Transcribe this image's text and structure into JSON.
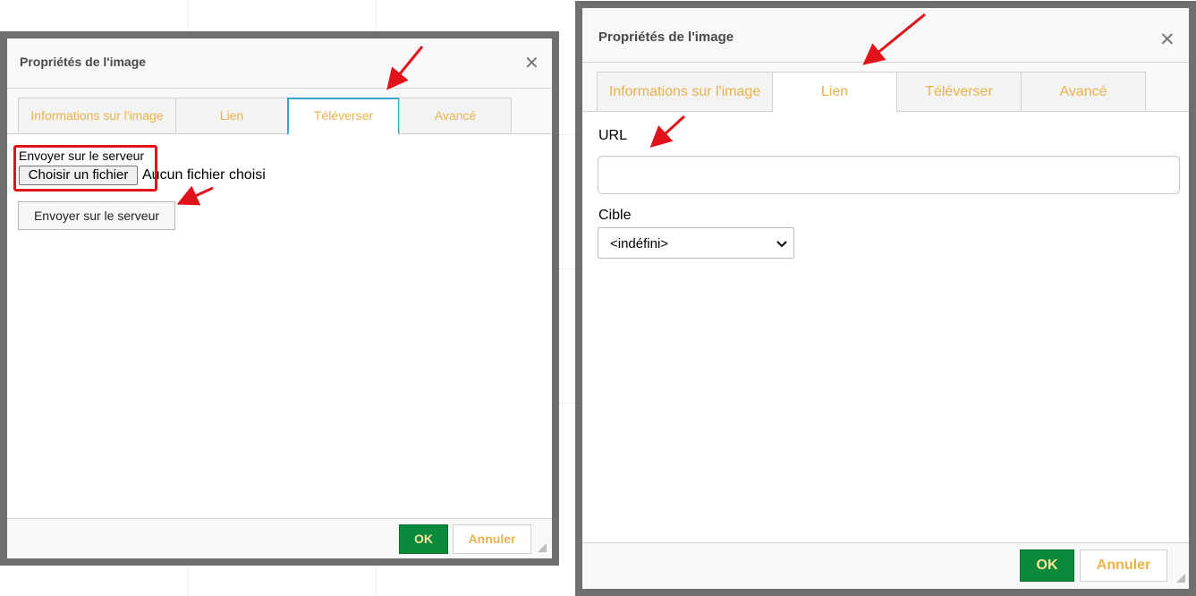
{
  "dialog_left": {
    "title": "Propriétés de l'image",
    "close_icon": "close-icon",
    "tabs": [
      {
        "label": "Informations sur l'image"
      },
      {
        "label": "Lien"
      },
      {
        "label": "Téléverser"
      },
      {
        "label": "Avancé"
      }
    ],
    "active_tab": "Téléverser",
    "upload_label": "Envoyer sur le serveur",
    "file_button": "Choisir un fichier",
    "file_status": "Aucun fichier choisi",
    "send_button": "Envoyer sur le serveur",
    "ok_button": "OK",
    "cancel_button": "Annuler"
  },
  "dialog_right": {
    "title": "Propriétés de l'image",
    "close_icon": "close-icon",
    "tabs": [
      {
        "label": "Informations sur l'image"
      },
      {
        "label": "Lien"
      },
      {
        "label": "Téléverser"
      },
      {
        "label": "Avancé"
      }
    ],
    "active_tab": "Lien",
    "url_label": "URL",
    "url_value": "",
    "target_label": "Cible",
    "target_value": "<indéfini>",
    "ok_button": "OK",
    "cancel_button": "Annuler"
  },
  "colors": {
    "accent_tab_text": "#e8b24c",
    "ok_button": "#0b8a3c",
    "annotation_red": "#e0131b",
    "active_tab_border": "#3ba6c8",
    "dialog_frame": "#6f6f6f"
  }
}
